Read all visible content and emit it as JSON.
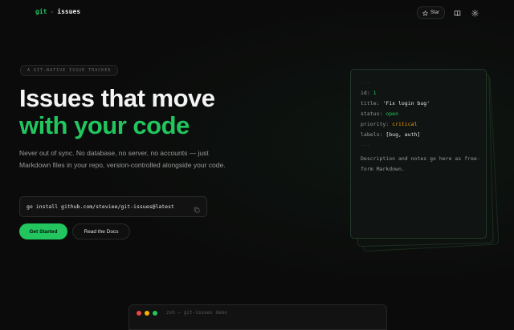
{
  "header": {
    "brand_git": "git",
    "brand_sep": "-",
    "brand_issues": "issues",
    "star_label": "Star"
  },
  "hero": {
    "tag": "A GIT-NATIVE ISSUE TRACKER",
    "title_line1": "Issues that move",
    "title_line2": "with your code",
    "lead": "Never out of sync. No database, no server, no accounts — just Markdown files in your repo, version-controlled alongside your code.",
    "install_cmd": "go install github.com/steviee/git-issues@latest",
    "primary_cta": "Get Started",
    "secondary_cta": "Read the Docs"
  },
  "card": {
    "dash_open": "---",
    "id_key": "id:",
    "id_val": "1",
    "title_key": "title:",
    "title_val": "'Fix login bug'",
    "status_key": "status:",
    "status_val": "open",
    "priority_key": "priority:",
    "priority_val": "critical",
    "labels_key": "labels:",
    "labels_val": "[bug, auth]",
    "dash_close": "---",
    "description": "Description and notes go here as free-form Markdown."
  },
  "terminal": {
    "title": "zsh — git-issues demo"
  },
  "colors": {
    "accent": "#22c55e",
    "warning": "#f59e0b",
    "background": "#0b0b0b",
    "dot_red": "#ef4444",
    "dot_yellow": "#f5b400",
    "dot_green": "#22c55e"
  },
  "icons": {
    "star": "star-icon",
    "docs": "book-icon",
    "theme": "sun-icon",
    "copy": "copy-icon"
  }
}
